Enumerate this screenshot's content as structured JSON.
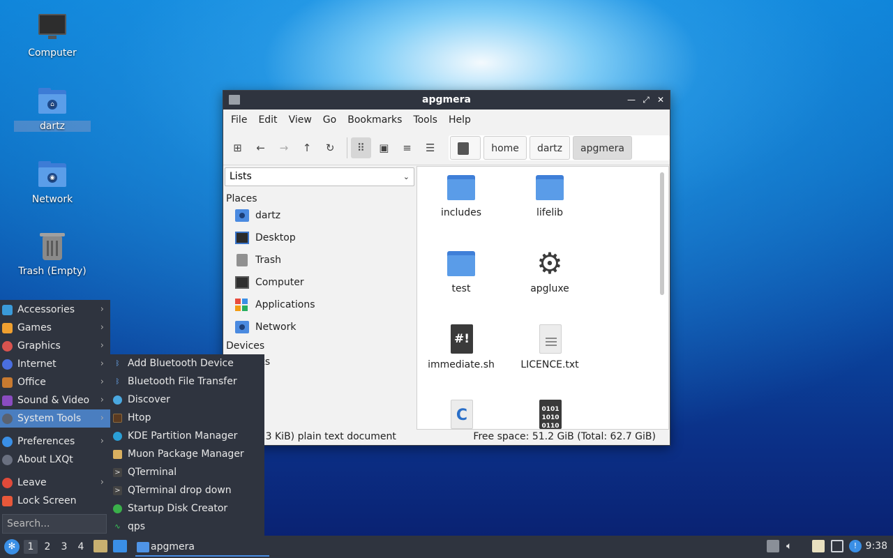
{
  "desktop": {
    "icons": [
      {
        "label": "Computer"
      },
      {
        "label": "dartz"
      },
      {
        "label": "Network"
      },
      {
        "label": "Trash (Empty)"
      }
    ]
  },
  "window": {
    "title": "apgmera",
    "menu": [
      "File",
      "Edit",
      "View",
      "Go",
      "Bookmarks",
      "Tools",
      "Help"
    ],
    "path": [
      "/",
      "home",
      "dartz",
      "apgmera"
    ],
    "side_combo": "Lists",
    "places_header": "Places",
    "places": [
      "dartz",
      "Desktop",
      "Trash",
      "Computer",
      "Applications",
      "Network"
    ],
    "devices_header": "Devices",
    "bookmarks_header_partial": "rks",
    "files": [
      "includes",
      "lifelib",
      "test",
      "apgluxe",
      "immediate.sh",
      "LICENCE.txt"
    ],
    "status_left": "out\" (2.3 KiB) plain text document",
    "status_right": "Free space: 51.2 GiB (Total: 62.7 GiB)"
  },
  "start_menu": {
    "items": [
      "Accessories",
      "Games",
      "Graphics",
      "Internet",
      "Office",
      "Sound & Video",
      "System Tools",
      "Preferences",
      "About LXQt",
      "Leave",
      "Lock Screen"
    ],
    "search_placeholder": "Search..."
  },
  "system_tools_submenu": [
    "Add Bluetooth Device",
    "Bluetooth File Transfer",
    "Discover",
    "Htop",
    "KDE Partition Manager",
    "Muon Package Manager",
    "QTerminal",
    "QTerminal drop down",
    "Startup Disk Creator",
    "qps"
  ],
  "taskbar": {
    "desktops": [
      "1",
      "2",
      "3",
      "4"
    ],
    "task_label": "apgmera",
    "clock": "9:38"
  },
  "colors": {
    "panel": "#2f343f",
    "highlight": "#4a7ec0",
    "folder": "#5a9ce8"
  }
}
